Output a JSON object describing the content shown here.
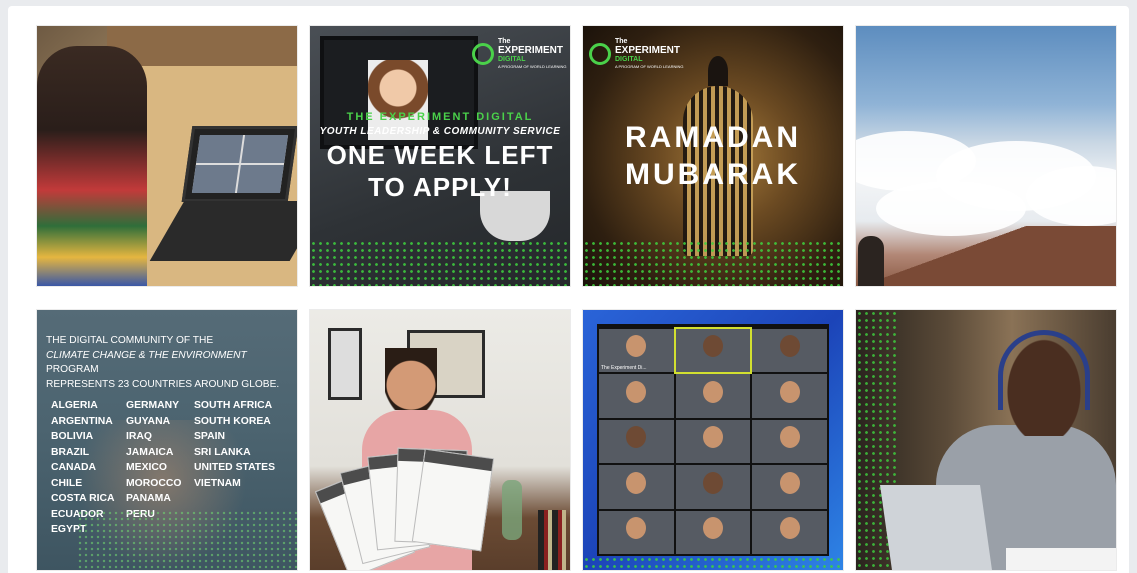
{
  "grid": {
    "tiles": [
      {
        "id": 0,
        "alt": "student on a laptop video call"
      },
      {
        "id": 1,
        "alt": "one week left to apply"
      },
      {
        "id": 2,
        "alt": "ramadan mubarak"
      },
      {
        "id": 3,
        "alt": "sea of clouds"
      },
      {
        "id": 4,
        "alt": "climate change countries"
      },
      {
        "id": 5,
        "alt": "boy holding certificates"
      },
      {
        "id": 6,
        "alt": "video call participants"
      },
      {
        "id": 7,
        "alt": "student with headphones"
      }
    ]
  },
  "logo": {
    "the": "The",
    "name": "EXPERIMENT",
    "sub": "DIGITAL",
    "tagline": "A PROGRAM OF WORLD LEARNING"
  },
  "tile1": {
    "line1": "THE EXPERIMENT DIGITAL",
    "line2": "YOUTH LEADERSHIP & COMMUNITY SERVICE",
    "line3": "ONE WEEK LEFT",
    "line4": "TO APPLY!"
  },
  "tile2": {
    "line1": "RAMADAN",
    "line2": "MUBARAK"
  },
  "tile4": {
    "intro1": "THE DIGITAL COMMUNITY OF THE",
    "intro2": "CLIMATE CHANGE & THE ENVIRONMENT",
    "intro3": " PROGRAM",
    "intro4": "REPRESENTS 23 COUNTRIES AROUND GLOBE.",
    "col1": [
      "ALGERIA",
      "ARGENTINA",
      "BOLIVIA",
      "BRAZIL",
      "CANADA",
      "CHILE",
      "COSTA RICA",
      "ECUADOR",
      "EGYPT"
    ],
    "col2": [
      "GERMANY",
      "GUYANA",
      "IRAQ",
      "JAMAICA",
      "MEXICO",
      "MOROCCO",
      "PANAMA",
      "PERU"
    ],
    "col3": [
      "SOUTH AFRICA",
      "SOUTH KOREA",
      "SPAIN",
      "SRI LANKA",
      "UNITED STATES",
      "VIETNAM"
    ]
  },
  "tile6": {
    "participant_label": "The Experiment Di..."
  },
  "colors": {
    "accent_green": "#4ad14a",
    "page_bg": "#e9ebee"
  }
}
